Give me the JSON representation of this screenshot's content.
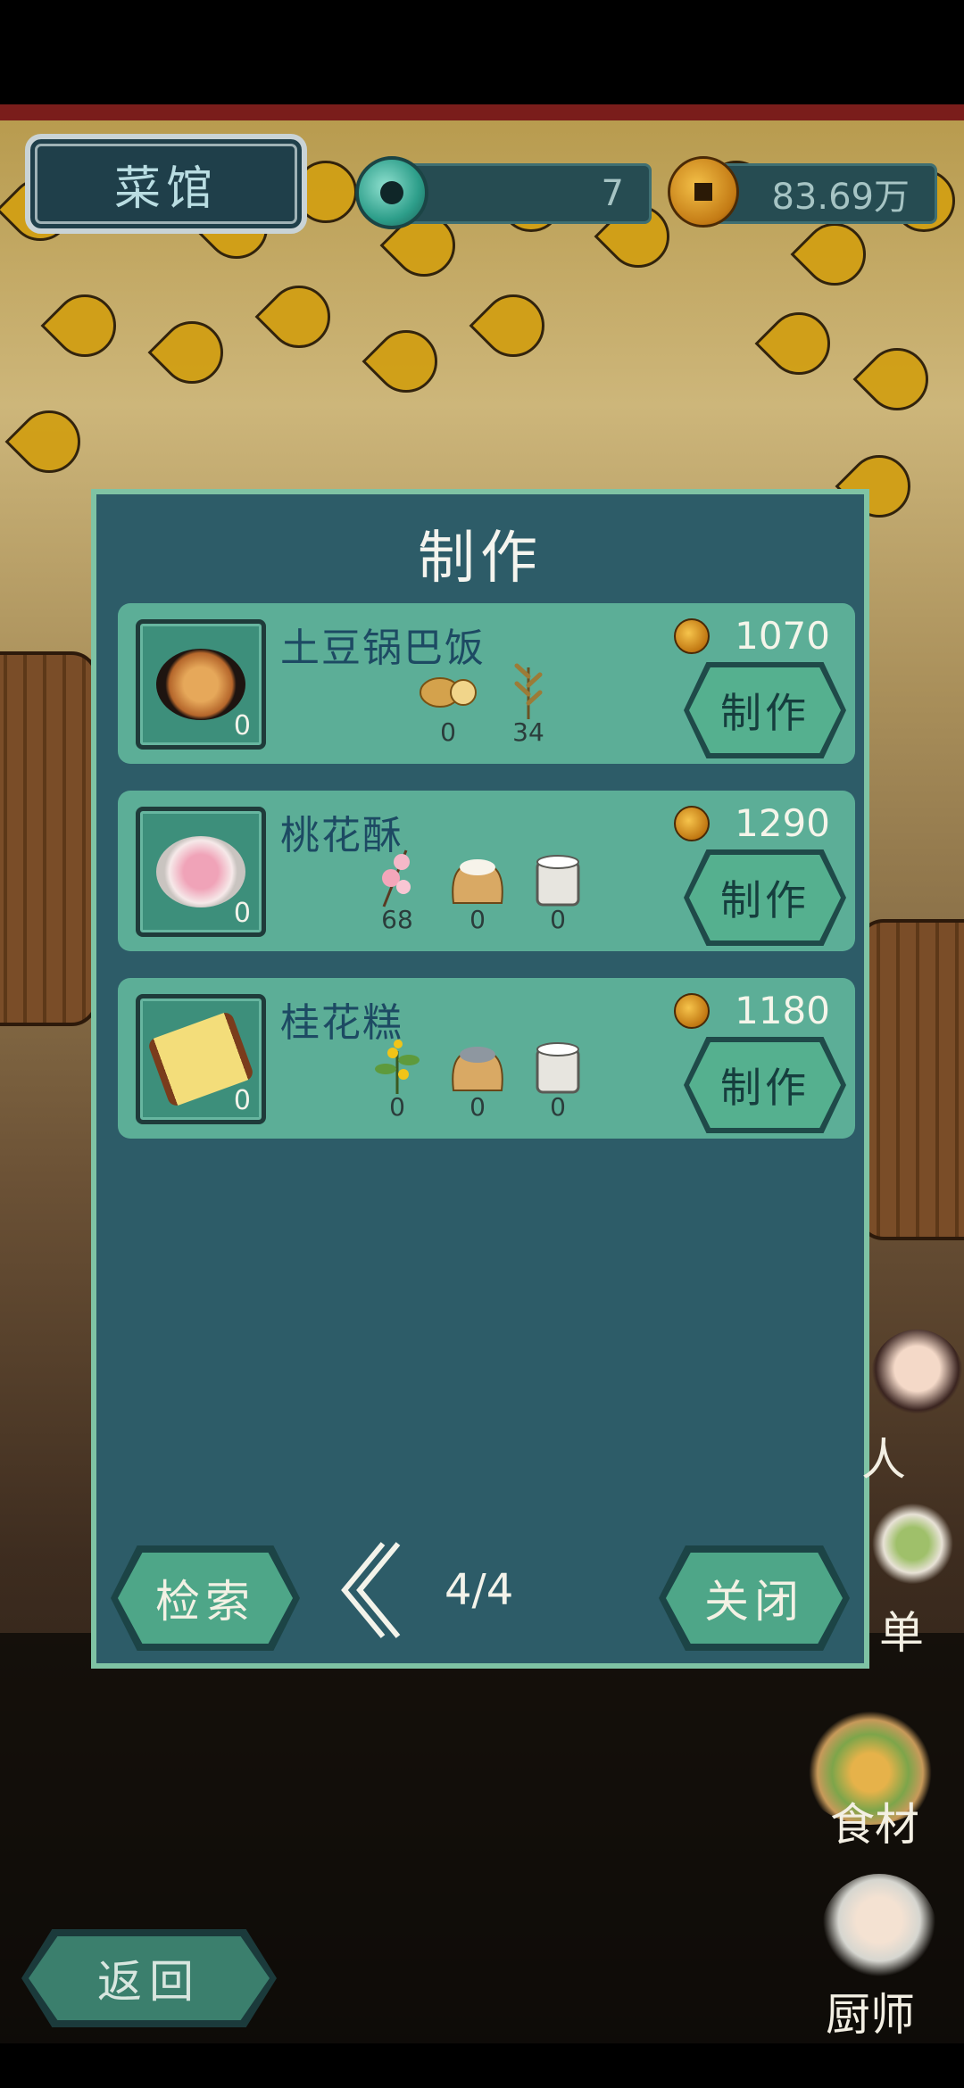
{
  "hud": {
    "title": "菜馆",
    "jade_count": "7",
    "coins": "83.69万"
  },
  "dialog": {
    "title": "制作",
    "recipes": [
      {
        "name": "土豆锅巴饭",
        "owned": "0",
        "price": "1070",
        "craft_label": "制作",
        "ingredients": [
          {
            "icon": "potato-icon",
            "qty": "0"
          },
          {
            "icon": "millet-stalk-icon",
            "qty": "34"
          }
        ]
      },
      {
        "name": "桃花酥",
        "owned": "0",
        "price": "1290",
        "craft_label": "制作",
        "ingredients": [
          {
            "icon": "peach-blossom-icon",
            "qty": "68"
          },
          {
            "icon": "flour-sack-icon",
            "qty": "0"
          },
          {
            "icon": "lard-pot-icon",
            "qty": "0"
          }
        ]
      },
      {
        "name": "桂花糕",
        "owned": "0",
        "price": "1180",
        "craft_label": "制作",
        "ingredients": [
          {
            "icon": "osmanthus-icon",
            "qty": "0"
          },
          {
            "icon": "rice-sack-icon",
            "qty": "0"
          },
          {
            "icon": "lard-pot-icon",
            "qty": "0"
          }
        ]
      }
    ],
    "search_label": "检索",
    "page": "4/4",
    "close_label": "关闭"
  },
  "side_menu": {
    "staff_label": "人",
    "menu_label": "单",
    "ingredients_label": "食材",
    "chef_label": "厨师"
  },
  "back_label": "返回"
}
